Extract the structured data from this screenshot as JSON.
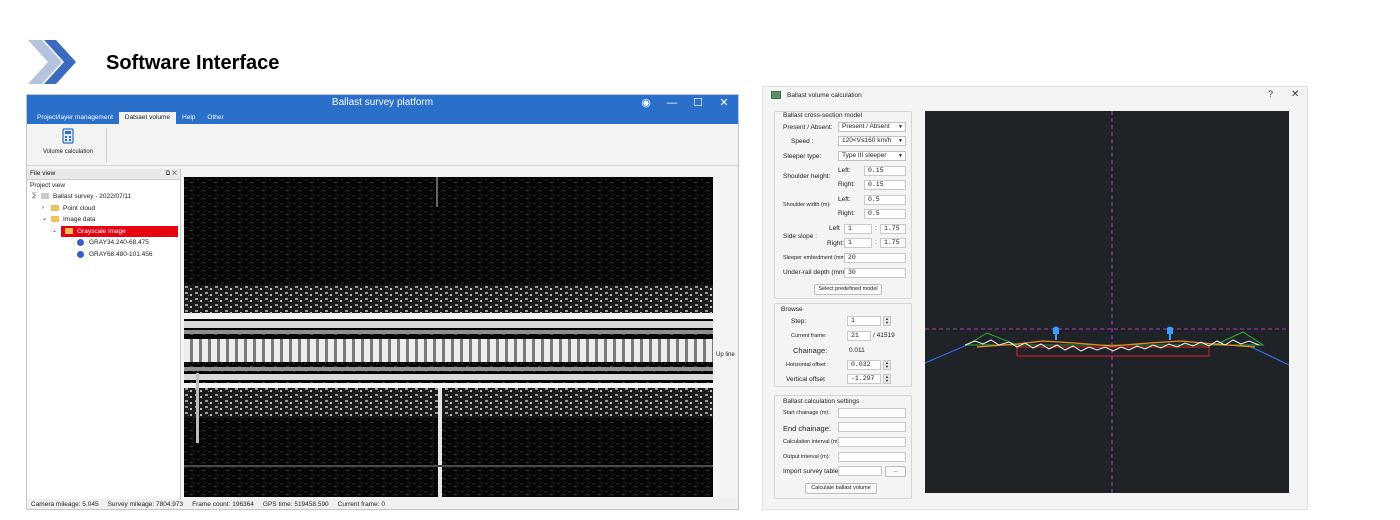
{
  "slide": {
    "title": "Software Interface"
  },
  "left_window": {
    "title": "Ballast survey platform",
    "menu": [
      {
        "label": "Project/layer management",
        "active": false
      },
      {
        "label": "Datsaet volume",
        "active": true
      },
      {
        "label": "Help",
        "active": false
      },
      {
        "label": "Other",
        "active": false
      }
    ],
    "ribbon_button": "Volume calculation",
    "file_view": {
      "title": "File view",
      "subtitle": "Project view",
      "tree": {
        "root": "Ballast survey - 2022/07/11",
        "point_cloud": "Point cloud",
        "image_data": "Image data",
        "grayscale": "Grayscale image",
        "item1": "GRAY34.240-68.475",
        "item2": "GRAY68.480-101.456"
      }
    },
    "image_label": "Up line",
    "status": {
      "camera": "Camera mileage:  5.045",
      "survey": "Survey mileage:  7804.973",
      "frames": "Frame count:  196364",
      "gps": "GPS time:  519458.590",
      "current": "Current frame:  0"
    }
  },
  "right_window": {
    "title": "Ballast volume calculation",
    "help": "?",
    "close": "✕",
    "model": {
      "title": "Ballast cross-section model",
      "present_label": "Present / Absent:",
      "present_value": "Present / Absent",
      "speed_label": "Speed :",
      "speed_value": "120<V≤160 km/h",
      "sleeper_label": "Sleeper type:",
      "sleeper_value": "Type III sleeper",
      "shoulder_height_label": "Shoulder height:",
      "left_label": "Left:",
      "right_label": "Right:",
      "sh_left": "0.15",
      "sh_right": "0.15",
      "shoulder_width_label": "Shoulder width (m):",
      "sw_left": "0.5",
      "sw_right": "0.5",
      "side_slope_label": "Side slope :",
      "slope_left_label": "Left",
      "slope_right_label": "Right:",
      "ss_left_a": "1",
      "ss_left_b": "1.75",
      "ss_right_a": "1",
      "ss_right_b": "1.75",
      "colon": ":",
      "embed_label": "Sleeper embedment (mm):",
      "embed_value": "20",
      "underrail_label": "Under-rail depth (mm):",
      "underrail_value": "30",
      "predefined_button": "Select predefined model"
    },
    "browse": {
      "title": "Browse",
      "step_label": "Step:",
      "step_value": "1",
      "frame_label": "Current frame:",
      "frame_value": "21",
      "frame_total": "/ 41519",
      "chainage_label": "Chainage:",
      "chainage_value": "0.011",
      "hoffset_label": "Horizontal offset :",
      "hoffset_value": "0.032",
      "voffset_label": "Vertical offset",
      "voffset_value": "-1.297"
    },
    "calc": {
      "title": "Ballast calculation settings",
      "start_label": "Start chainage (m):",
      "end_label": "End chainage:",
      "interval_label": "Calculation interval (m):",
      "output_label": "Output interval (m):",
      "import_label": "Import survey table",
      "browse_button": "...",
      "calc_button": "Calculate ballast volume"
    }
  },
  "colors": {
    "accent": "#2a6fc9",
    "selection": "#e60012",
    "canvas": "#1f2226"
  }
}
